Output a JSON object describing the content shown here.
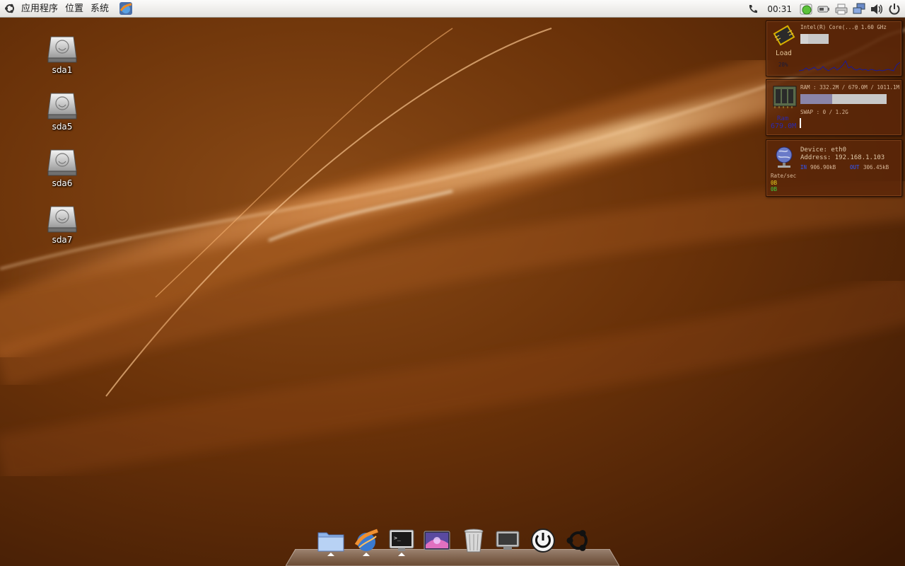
{
  "top_panel": {
    "menus": [
      "应用程序",
      "位置",
      "系统"
    ],
    "clock": "00:31"
  },
  "desktop_icons": [
    {
      "label": "sda1"
    },
    {
      "label": "sda5"
    },
    {
      "label": "sda6"
    },
    {
      "label": "sda7"
    }
  ],
  "cpu_widget": {
    "cpu_name": "Intel(R) Core(...@ 1.60 GHz",
    "label": "Load",
    "percent": "28%",
    "load_fraction": 0.28
  },
  "ram_widget": {
    "ram_line": "RAM : 332.2M / 679.0M / 1011.1M",
    "swap_line": "SWAP : 0 / 1.2G",
    "label": "Ram",
    "value": "679.0M",
    "ram_fraction": 0.37
  },
  "net_widget": {
    "device": "Device: eth0",
    "address": "Address: 192.168.1.103",
    "in_label": "IN",
    "in_value": "906.90kB",
    "out_label": "OUT",
    "out_value": "306.45kB",
    "rate_label": "Rate/sec",
    "rate_in": "0B",
    "rate_out": "0B"
  },
  "dock": {
    "items": [
      "folder-icon",
      "browser-icon",
      "terminal-icon",
      "image-viewer-icon",
      "trash-icon",
      "display-icon",
      "power-icon",
      "ubuntu-icon"
    ]
  }
}
